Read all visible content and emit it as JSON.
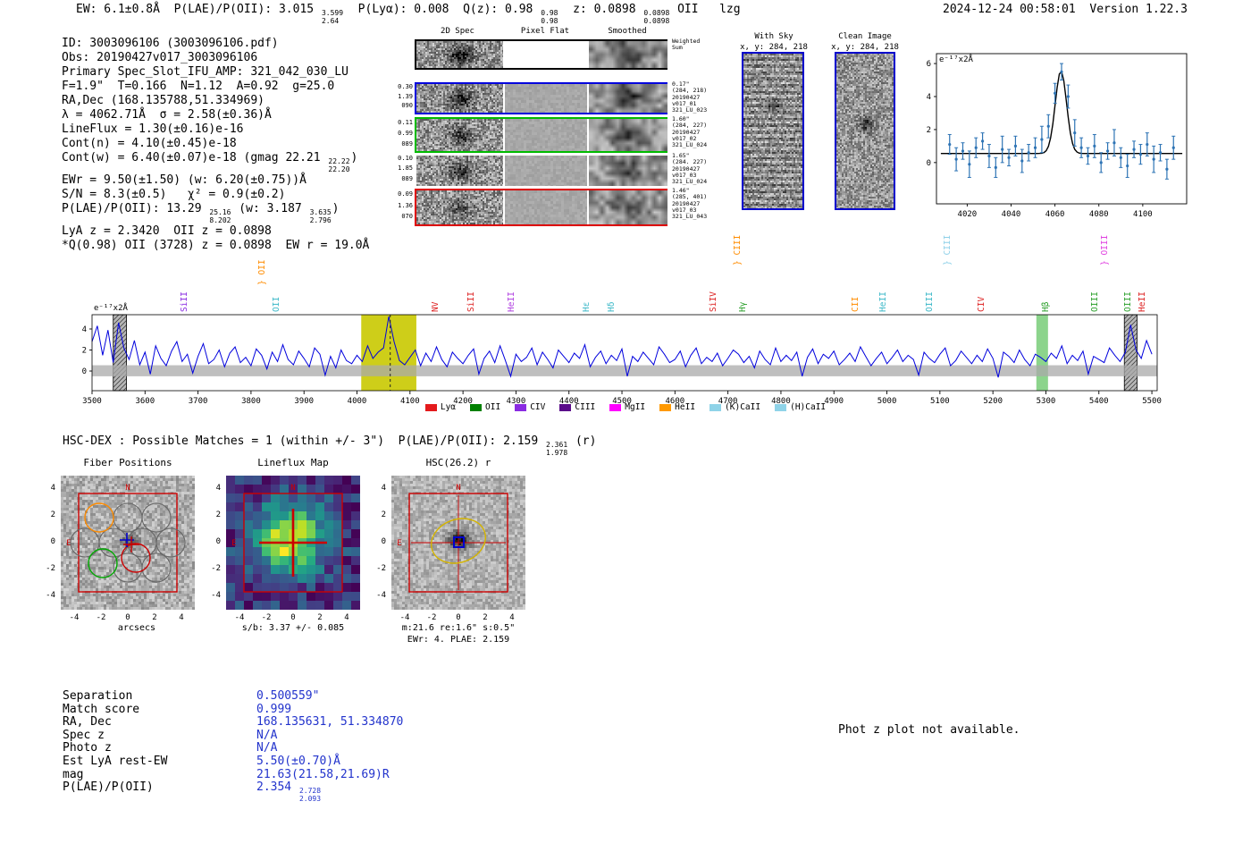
{
  "meta": {
    "timestamp": "2024-12-24 00:58:01",
    "version": "Version 1.22.3"
  },
  "header": {
    "rich": [
      "EW: 6.1±0.8Å  P(LAE)/P(OII): 3.015 ",
      {
        "hi": "3.599",
        "lo": "2.64"
      },
      "  P(Lyα): 0.008  Q(z): 0.98 ",
      {
        "hi": "0.98",
        "lo": "0.98"
      },
      "  z: 0.0898 ",
      {
        "hi": "0.0898",
        "lo": "0.0898"
      },
      " OII   lzg"
    ]
  },
  "info": {
    "lines": [
      [
        "ID: 3003096106 (3003096106.pdf)"
      ],
      [
        "Obs: 20190427v017_3003096106"
      ],
      [
        "Primary Spec_Slot_IFU_AMP: 321_042_030_LU"
      ],
      [
        "F=1.9\"  T=0.166  N=1.12  A=0.92  g=25.0"
      ],
      [
        "RA,Dec (168.135788,51.334969)"
      ],
      [
        "λ = 4062.71Å  σ = 2.58(±0.36)Å"
      ],
      [
        "LineFlux = 1.30(±0.16)e-16"
      ],
      [
        "Cont(n) = 4.10(±0.45)e-18"
      ],
      [
        "Cont(w) = 6.40(±0.07)e-18 (gmag 22.21 ",
        {
          "hi": "22.22",
          "lo": "22.20"
        },
        ")"
      ],
      [
        "EWr = 9.50(±1.50) (w: 6.20(±0.75))Å"
      ],
      [
        "S/N = 8.3(±0.5)   χ² = 0.9(±0.2)"
      ],
      [
        "P(LAE)/P(OII): 13.29 ",
        {
          "hi": "25.16",
          "lo": "8.202"
        },
        " (w: 3.187 ",
        {
          "hi": "3.635",
          "lo": "2.796"
        },
        ")"
      ],
      [
        "LyA z = 2.3420  OII z = 0.0898"
      ],
      [
        "*Q(0.98) OII (3728) z = 0.0898  EW r = 19.0Å"
      ]
    ]
  },
  "grid2d": {
    "col_headers": [
      "2D Spec",
      "Pixel Flat",
      "Smoothed"
    ],
    "rows": [
      {
        "left": [],
        "right": [
          "Weighted",
          "Sum"
        ],
        "border": "#000000"
      },
      {
        "left": [
          "0.30",
          "1.39",
          "090"
        ],
        "right": [
          "0.17\"",
          "(284, 218)",
          "20190427",
          "v017_01",
          "321_LU_023"
        ],
        "border": "#0000dd"
      },
      {
        "left": [
          "0.11",
          "0.99",
          "089"
        ],
        "right": [
          "1.60\"",
          "(284, 227)",
          "20190427",
          "v017_02",
          "321_LU_024"
        ],
        "border": "#00bb00"
      },
      {
        "left": [
          "0.10",
          "1.85",
          "089"
        ],
        "right": [
          "1.65\"",
          "(284. 227)",
          "20190427",
          "v017_03",
          "321_LU_024"
        ],
        "border": null
      },
      {
        "left": [
          "0.09",
          "1.36",
          "070"
        ],
        "right": [
          "1.46\"",
          "(285, 401)",
          "20190427",
          "v017_03",
          "321_LU_043"
        ],
        "border": "#dd0000"
      }
    ]
  },
  "sky": {
    "withsky": {
      "title": "With Sky",
      "coords": "x, y: 284, 218"
    },
    "clean": {
      "title": "Clean Image",
      "coords": "x, y: 284, 218"
    }
  },
  "hscdex": {
    "rich": [
      "HSC-DEX : Possible Matches = 1 (within +/- 3\")  P(LAE)/P(OII): 2.159 ",
      {
        "hi": "2.361",
        "lo": "1.978"
      },
      " (r)"
    ]
  },
  "cutouts": {
    "ticks_y": [
      4,
      2,
      0,
      -2,
      -4
    ],
    "ticks_x": [
      -4,
      -2,
      0,
      2,
      4
    ],
    "compass": {
      "north": "N",
      "east": "E"
    },
    "panels": [
      {
        "title": "Fiber Positions",
        "xlabel": "arcsecs",
        "caption": "",
        "caption2": ""
      },
      {
        "title": "Lineflux Map",
        "xlabel": "",
        "caption": "s/b: 3.37 +/- 0.085",
        "caption2": ""
      },
      {
        "title": "HSC(26.2) r",
        "xlabel": "",
        "caption": "m:21.6 re:1.6\" s:0.5\"",
        "caption2": "EWr: 4. PLAE: 2.159"
      }
    ]
  },
  "match": {
    "rows": [
      {
        "label": "Separation",
        "value": [
          "0.500559\""
        ]
      },
      {
        "label": "Match score",
        "value": [
          "0.999"
        ]
      },
      {
        "label": "RA, Dec",
        "value": [
          "168.135631, 51.334870"
        ]
      },
      {
        "label": "Spec z",
        "value": [
          "N/A"
        ]
      },
      {
        "label": "Photo z",
        "value": [
          "N/A"
        ]
      },
      {
        "label": "Est LyA rest-EW",
        "value": [
          "5.50(±0.70)Å"
        ]
      },
      {
        "label": "mag",
        "value": [
          "21.63(21.58,21.69)R"
        ]
      },
      {
        "label": "P(LAE)/P(OII)",
        "value": [
          "2.354 ",
          {
            "hi": "2.728",
            "lo": "2.093"
          }
        ]
      }
    ]
  },
  "notes": {
    "photz": "Phot z plot not available."
  },
  "chart_data": [
    {
      "id": "line-fit-zoom",
      "type": "scatter",
      "annotation": "e⁻¹⁷x2Å",
      "xlim": [
        4006,
        4120
      ],
      "ylim": [
        -2.5,
        6.6
      ],
      "x_ticks": [
        4020,
        4040,
        4060,
        4080,
        4100
      ],
      "y_ticks": [
        0,
        2,
        4,
        6
      ],
      "fit": {
        "center": 4062.71,
        "sigma": 2.58,
        "amplitude": 5.0,
        "continuum": 0.55
      },
      "point_color": "#2e74b5",
      "fit_color": "#000000",
      "points": {
        "x": [
          4012,
          4015,
          4018,
          4021,
          4024,
          4027,
          4030,
          4033,
          4036,
          4039,
          4042,
          4045,
          4048,
          4051,
          4054,
          4057,
          4060,
          4063,
          4066,
          4069,
          4072,
          4075,
          4078,
          4081,
          4084,
          4087,
          4090,
          4093,
          4096,
          4099,
          4102,
          4105,
          4108,
          4111,
          4114
        ],
        "y": [
          1.1,
          0.2,
          0.7,
          -0.1,
          0.9,
          1.3,
          0.4,
          -0.3,
          0.8,
          0.3,
          1.0,
          0.1,
          0.6,
          0.9,
          1.4,
          2.2,
          4.2,
          5.5,
          4.0,
          1.8,
          0.9,
          0.4,
          1.0,
          0.0,
          0.7,
          1.2,
          0.3,
          -0.2,
          0.8,
          0.5,
          1.1,
          0.2,
          0.6,
          -0.4,
          0.9
        ],
        "err": [
          0.6,
          0.7,
          0.5,
          0.8,
          0.6,
          0.5,
          0.7,
          0.6,
          0.8,
          0.5,
          0.6,
          0.7,
          0.5,
          0.6,
          0.8,
          0.7,
          0.6,
          0.5,
          0.7,
          0.8,
          0.6,
          0.5,
          0.7,
          0.6,
          0.5,
          0.8,
          0.6,
          0.7,
          0.5,
          0.6,
          0.7,
          0.8,
          0.5,
          0.6,
          0.7
        ]
      }
    },
    {
      "id": "full-spectrum",
      "type": "line",
      "annotation": "e⁻¹⁷x2Å",
      "xlim": [
        3500,
        5510
      ],
      "ylim": [
        -1.87,
        5.36
      ],
      "x_ticks": [
        3500,
        3600,
        3700,
        3800,
        3900,
        4000,
        4100,
        4200,
        4300,
        4400,
        4500,
        4600,
        4700,
        4800,
        4900,
        5000,
        5100,
        5200,
        5300,
        5400,
        5500
      ],
      "y_ticks": [
        0,
        2,
        4
      ],
      "line_color": "#0000dd",
      "emission_line": {
        "x": 4062.71
      },
      "noise_band": {
        "lo": -0.5,
        "hi": 0.55,
        "color": "#aaaaaa"
      },
      "bands": [
        {
          "x0": 4008,
          "x1": 4112,
          "color": "#c9c900",
          "opacity": 0.9,
          "style": "solid",
          "name": "selected-line-region"
        },
        {
          "x0": 5282,
          "x1": 5304,
          "color": "#00a000",
          "opacity": 0.45,
          "style": "solid",
          "name": "hbeta-region"
        },
        {
          "x0": 3540,
          "x1": 3565,
          "color": "#999999",
          "opacity": 0.7,
          "style": "hatch",
          "name": "sky-region-blue"
        },
        {
          "x0": 5448,
          "x1": 5472,
          "color": "#999999",
          "opacity": 0.7,
          "style": "hatch",
          "name": "sky-region-red"
        }
      ],
      "line_labels": [
        {
          "text": "SiII",
          "x": 3672,
          "color": "#8a2be2",
          "tier": 0
        },
        {
          "text": "} OII",
          "x": 3818,
          "color": "#ff8c00",
          "tier": 1
        },
        {
          "text": "OII",
          "x": 3846,
          "color": "#3cb8c8",
          "tier": 0
        },
        {
          "text": "NV",
          "x": 4146,
          "color": "#dd2222",
          "tier": 0
        },
        {
          "text": "SiII",
          "x": 4214,
          "color": "#dd2222",
          "tier": 0
        },
        {
          "text": "HeII",
          "x": 4290,
          "color": "#b040e0",
          "tier": 0
        },
        {
          "text": "Hε",
          "x": 4430,
          "color": "#3cb8c8",
          "tier": 0
        },
        {
          "text": "Hδ",
          "x": 4478,
          "color": "#3cb8c8",
          "tier": 0
        },
        {
          "text": "SiIV",
          "x": 4670,
          "color": "#dd2222",
          "tier": 0
        },
        {
          "text": "} CIII",
          "x": 4716,
          "color": "#ff8c00",
          "tier": 2
        },
        {
          "text": "Hγ",
          "x": 4726,
          "color": "#2ca02c",
          "tier": 0
        },
        {
          "text": "CII",
          "x": 4938,
          "color": "#ff8c00",
          "tier": 0
        },
        {
          "text": "HeII",
          "x": 4990,
          "color": "#3cb8c8",
          "tier": 0
        },
        {
          "text": "OIII",
          "x": 5078,
          "color": "#3cb8c8",
          "tier": 0
        },
        {
          "text": "} CIII",
          "x": 5112,
          "color": "#8ed0e8",
          "tier": 2
        },
        {
          "text": "CIV",
          "x": 5176,
          "color": "#dd2222",
          "tier": 0
        },
        {
          "text": "Hβ",
          "x": 5297,
          "color": "#2ca02c",
          "tier": 0
        },
        {
          "text": "OIII",
          "x": 5390,
          "color": "#2ca02c",
          "tier": 0
        },
        {
          "text": "} OIII",
          "x": 5408,
          "color": "#e040e0",
          "tier": 2
        },
        {
          "text": "OIII",
          "x": 5452,
          "color": "#2ca02c",
          "tier": 0
        },
        {
          "text": "HeII",
          "x": 5480,
          "color": "#dd2222",
          "tier": 0
        }
      ],
      "legend": [
        {
          "label": "Lyα",
          "color": "#e41a1c"
        },
        {
          "label": "OII",
          "color": "#008000"
        },
        {
          "label": "CIV",
          "color": "#8a2be2"
        },
        {
          "label": "CIII",
          "color": "#5a0a8a"
        },
        {
          "label": "MgII",
          "color": "#ff00ff"
        },
        {
          "label": "HeII",
          "color": "#ff9900"
        },
        {
          "label": "(K)CaII",
          "color": "#8fd3e8"
        },
        {
          "label": "(H)CaII",
          "color": "#8fd3e8"
        }
      ],
      "spectrum": {
        "x_start": 3500,
        "x_step": 10,
        "values": [
          2.8,
          4.3,
          1.5,
          3.9,
          0.8,
          4.6,
          2.2,
          1.1,
          2.9,
          0.6,
          1.8,
          -0.3,
          2.4,
          1.2,
          0.5,
          1.9,
          2.8,
          0.9,
          1.6,
          -0.2,
          1.4,
          2.6,
          0.7,
          1.1,
          2.0,
          0.4,
          1.7,
          2.3,
          0.8,
          1.3,
          0.5,
          2.1,
          1.5,
          0.2,
          1.8,
          0.9,
          2.5,
          1.1,
          0.6,
          1.9,
          1.2,
          0.4,
          2.2,
          1.6,
          -0.4,
          1.4,
          0.3,
          2.0,
          1.0,
          0.7,
          1.5,
          0.9,
          2.4,
          1.2,
          1.8,
          2.2,
          5.2,
          2.8,
          1.0,
          0.6,
          1.3,
          2.0,
          0.5,
          1.7,
          0.9,
          2.3,
          1.1,
          0.4,
          1.8,
          1.2,
          0.7,
          1.5,
          2.1,
          -0.3,
          1.2,
          1.9,
          0.8,
          2.4,
          1.0,
          -0.5,
          1.6,
          0.9,
          1.3,
          2.2,
          0.6,
          1.8,
          1.1,
          0.3,
          2.0,
          1.4,
          0.8,
          1.7,
          1.2,
          2.5,
          0.4,
          1.3,
          1.9,
          0.7,
          1.5,
          1.0,
          2.1,
          -0.5,
          1.4,
          0.9,
          1.8,
          1.2,
          0.6,
          2.3,
          1.6,
          0.8,
          1.1,
          1.9,
          0.4,
          1.5,
          2.2,
          0.7,
          1.3,
          0.9,
          1.7,
          0.5,
          1.2,
          2.0,
          1.6,
          0.8,
          1.4,
          0.3,
          1.9,
          1.1,
          0.6,
          2.2,
          0.9,
          1.5,
          1.0,
          1.8,
          -0.5,
          1.3,
          2.1,
          0.7,
          1.6,
          1.2,
          1.9,
          0.6,
          1.1,
          1.7,
          0.9,
          2.3,
          1.4,
          0.5,
          1.2,
          1.8,
          0.7,
          1.3,
          2.0,
          0.9,
          1.5,
          1.1,
          -0.4,
          1.8,
          1.2,
          0.8,
          1.6,
          2.2,
          0.5,
          1.0,
          1.9,
          1.3,
          0.7,
          1.5,
          0.9,
          2.1,
          1.2,
          -0.6,
          1.8,
          1.4,
          0.8,
          2.0,
          1.1,
          0.5,
          1.6,
          1.3,
          0.9,
          1.7,
          1.2,
          2.4,
          0.7,
          1.5,
          1.0,
          1.9,
          -0.3,
          1.4,
          1.1,
          0.8,
          2.2,
          1.5,
          0.9,
          1.8,
          4.4,
          2.0,
          1.2,
          2.9,
          1.6
        ]
      }
    }
  ]
}
